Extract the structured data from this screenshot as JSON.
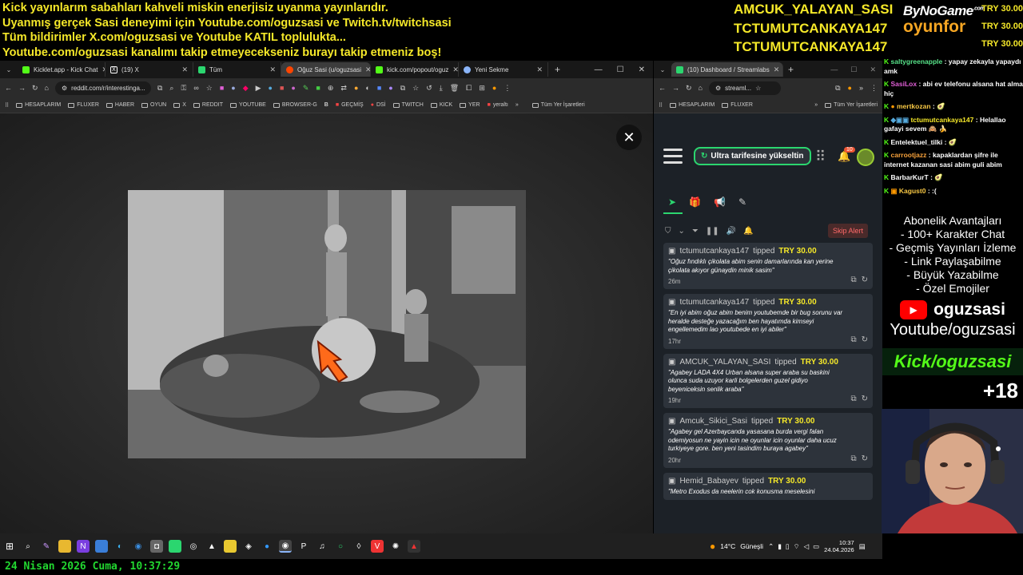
{
  "banner": {
    "lines": [
      "Kick yayınlarım sabahları kahveli miskin enerjisiz uyanma yayınlarıdır.",
      "Uyanmış gerçek Sasi deneyimi için Youtube.com/oguzsasi ve Twitch.tv/twitchsasi",
      "Tüm bildirimler X.com/oguzsasi ve Youtube KATIL toplulukta...",
      "Youtube.com/oguzsasi kanalımı takip etmeyecekseniz burayı takip etmeniz boş!"
    ]
  },
  "top_names": [
    "AMCUK_YALAYAN_SASI",
    "TCTUMUTCANKAYA147",
    "TCTUMUTCANKAYA147"
  ],
  "logo": {
    "line1": "ByNoGame",
    "sup": ".com",
    "line2": "oyunfor"
  },
  "top_tips": [
    "TRY 30.00",
    "TRY 30.00",
    "TRY 30.00"
  ],
  "browser_left": {
    "tabs": [
      {
        "label": "Kicklet.app - Kick Chat",
        "color": "#53fc18"
      },
      {
        "label": "(19) X",
        "color": "#ffffff"
      },
      {
        "label": "Tüm",
        "color": "#2bd66f"
      },
      {
        "label": "Oğuz Sasi (u/oguzsasi",
        "color": "#ff4500"
      },
      {
        "label": "kick.com/popout/oguz",
        "color": "#53fc18"
      },
      {
        "label": "Yeni Sekme",
        "color": "#8ab4f8"
      }
    ],
    "url": "reddit.com/r/interestinga...",
    "bookmarks": [
      "HESAPLARIM",
      "FLUXER",
      "HABER",
      "OYUN",
      "X",
      "REDDIT",
      "YOUTUBE",
      "BROWSER-G",
      "GEÇMİŞ",
      "DSİ",
      "TWITCH",
      "KICK",
      "YER",
      "yeraltı"
    ],
    "all_bookmarks": "Tüm Yer İşaretleri",
    "close_glyph": "✕"
  },
  "browser_right": {
    "tab_label": "(10) Dashboard / Streamlabs",
    "url": "streaml...",
    "bookmarks": [
      "HESAPLARIM",
      "FLUXER"
    ],
    "all_bookmarks": "Tüm Yer İşaretleri",
    "upgrade_label": "Ultra tarifesine yükseltin",
    "notif_count": "10",
    "skip_alert": "Skip Alert",
    "alerts": [
      {
        "user": "tctumutcankaya147",
        "action": "tipped",
        "amount": "TRY 30.00",
        "message": "\"Oğuz fındıklı çikolata abim senin damarlarında kan yerine çikolata akıyor günaydin minik sasim\"",
        "time": "26m"
      },
      {
        "user": "tctumutcankaya147",
        "action": "tipped",
        "amount": "TRY 30.00",
        "message": "\"En iyi abim oğuz abim benim youtubemde bir bug sorunu var heralde desteğe yazacağım ben hayatımda kimseyi engellemedim lao youtubede en iyi abiler\"",
        "time": "17hr"
      },
      {
        "user": "AMCUK_YALAYAN_SASI",
        "action": "tipped",
        "amount": "TRY 30.00",
        "message": "\"Agabey LADA 4X4 Urban alsana super araba su baskini olunca suda uzuyor karli bolgelerden guzel gidiyo beyeniceksin senlik araba\"",
        "time": "19hr"
      },
      {
        "user": "Amcuk_Sikici_Sasi",
        "action": "tipped",
        "amount": "TRY 30.00",
        "message": "\"Agabey gel Azerbaycanda yasasana burda vergi falan odemiyosun ne yayin icin ne oyunlar icin oyunlar daha ucuz turkiyeye gore. ben yeni tasindim buraya agabey\"",
        "time": "20hr"
      },
      {
        "user": "Hemid_Babayev",
        "action": "tipped",
        "amount": "TRY 30.00",
        "message": "\"Metro Exodus da neelerin cok konusma meselesini",
        "time": ""
      }
    ]
  },
  "chat": [
    {
      "user": "saltygreenapple",
      "color": "#57e389",
      "text": "yapay zekayla yapaydı amk"
    },
    {
      "user": "SasiLox",
      "color": "#e05fd6",
      "text": "abi ev telefonu alsana hat alma hiç"
    },
    {
      "user": "mertkozan",
      "color": "#f7c744",
      "text": "🥑"
    },
    {
      "user": "tctumutcankaya147",
      "color": "#f5e829",
      "text": "Helallao gafayi sevem 🙈 🍌"
    },
    {
      "user": "Entelektuel_tilki",
      "color": "#ffffff",
      "text": "🥑"
    },
    {
      "user": "carrootjazz",
      "color": "#f7a13b",
      "text": "kapaklardan şifre ile internet kazanan sasi abim guli abim"
    },
    {
      "user": "BarbarKurT",
      "color": "#ffffff",
      "text": "🥑"
    },
    {
      "user": "Kagust0",
      "color": "#f7c744",
      "text": ":("
    }
  ],
  "perks": {
    "title": "Abonelik Avantajları",
    "items": [
      "- 100+ Karakter Chat",
      "- Geçmiş Yayınları İzleme",
      "- Link Paylaşabilme",
      "- Büyük Yazabilme",
      "- Özel Emojiler"
    ]
  },
  "youtube": {
    "handle": "oguzsasi",
    "url": "Youtube/oguzsasi"
  },
  "kick": "Kick/oguzsasi",
  "age": "+18",
  "tray": {
    "weather": "14°C",
    "weather_label": "Güneşli",
    "time": "10:37",
    "date": "24.04.2026"
  },
  "datetime": "24 Nisan 2026 Cuma, 10:37:29",
  "colors": {
    "banner": "#f5e829",
    "kick_green": "#53fc18",
    "date_green": "#22d630"
  }
}
